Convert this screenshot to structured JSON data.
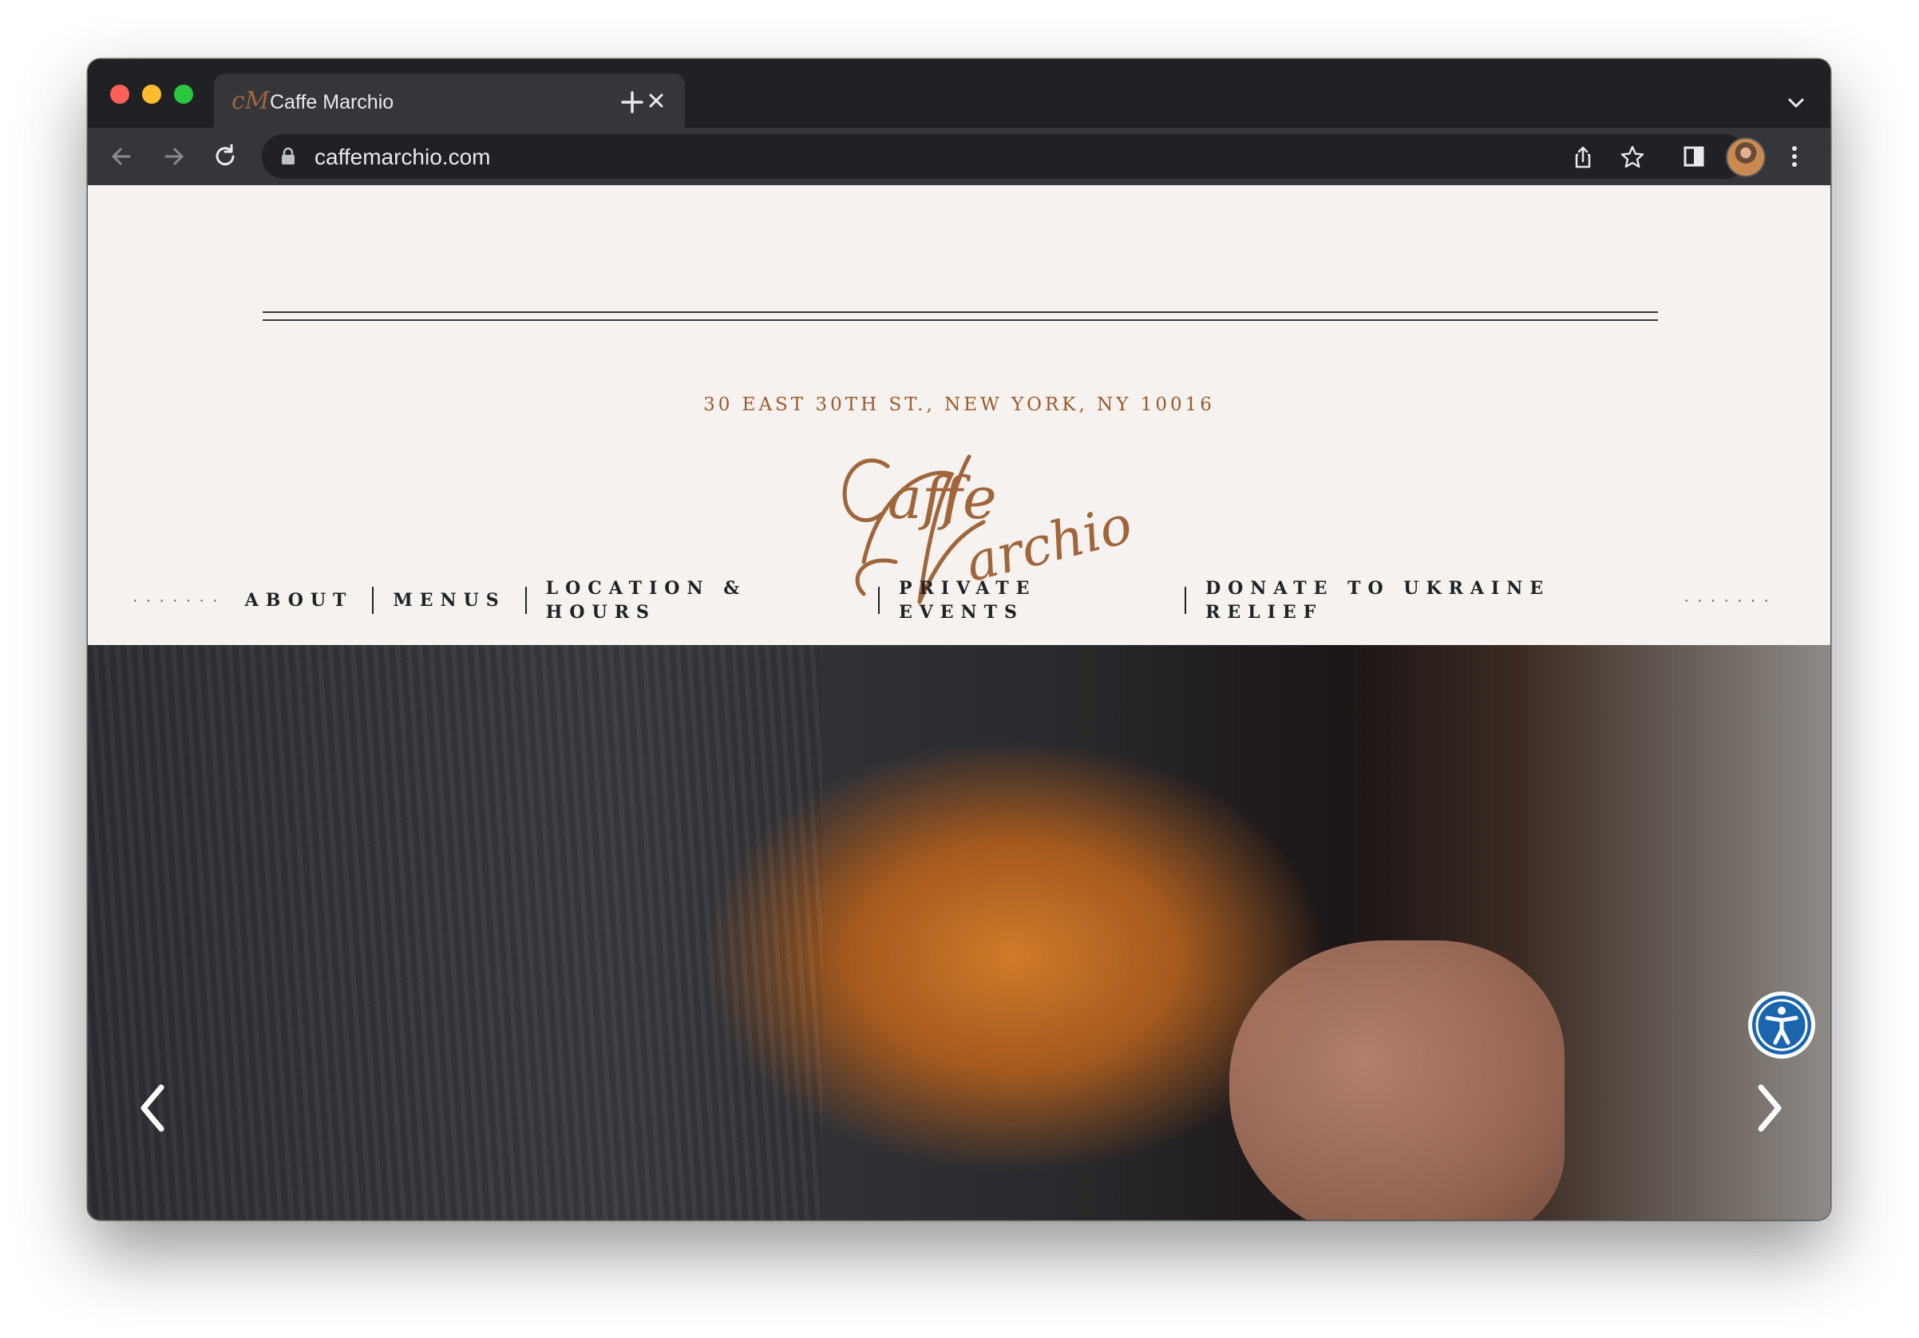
{
  "browser": {
    "tab": {
      "title": "Caffe Marchio"
    },
    "address_bar": {
      "url": "caffemarchio.com"
    }
  },
  "site": {
    "address": "30 EAST 30TH ST., NEW YORK, NY 10016",
    "logo_text": "Caffe Marchio",
    "nav": {
      "items": [
        {
          "label": "ABOUT"
        },
        {
          "label": "MENUS"
        },
        {
          "label": "LOCATION & HOURS"
        },
        {
          "label": "PRIVATE EVENTS"
        },
        {
          "label": "DONATE TO UKRAINE RELIEF"
        }
      ]
    }
  },
  "colors": {
    "page_bg": "#f5f2ef",
    "brand_copper": "#9b5b2c",
    "accessibility_blue": "#1b65ae"
  },
  "icons": {
    "tab_close": "close-icon",
    "new_tab": "plus-icon",
    "back": "arrow-left-icon",
    "forward": "arrow-right-icon",
    "reload": "reload-icon",
    "secure": "lock-icon",
    "share": "share-icon",
    "bookmark": "star-icon",
    "side_panel": "side-panel-icon",
    "menu": "kebab-menu-icon",
    "slider_prev": "chevron-left-icon",
    "slider_next": "chevron-right-icon",
    "accessibility": "accessibility-icon"
  }
}
